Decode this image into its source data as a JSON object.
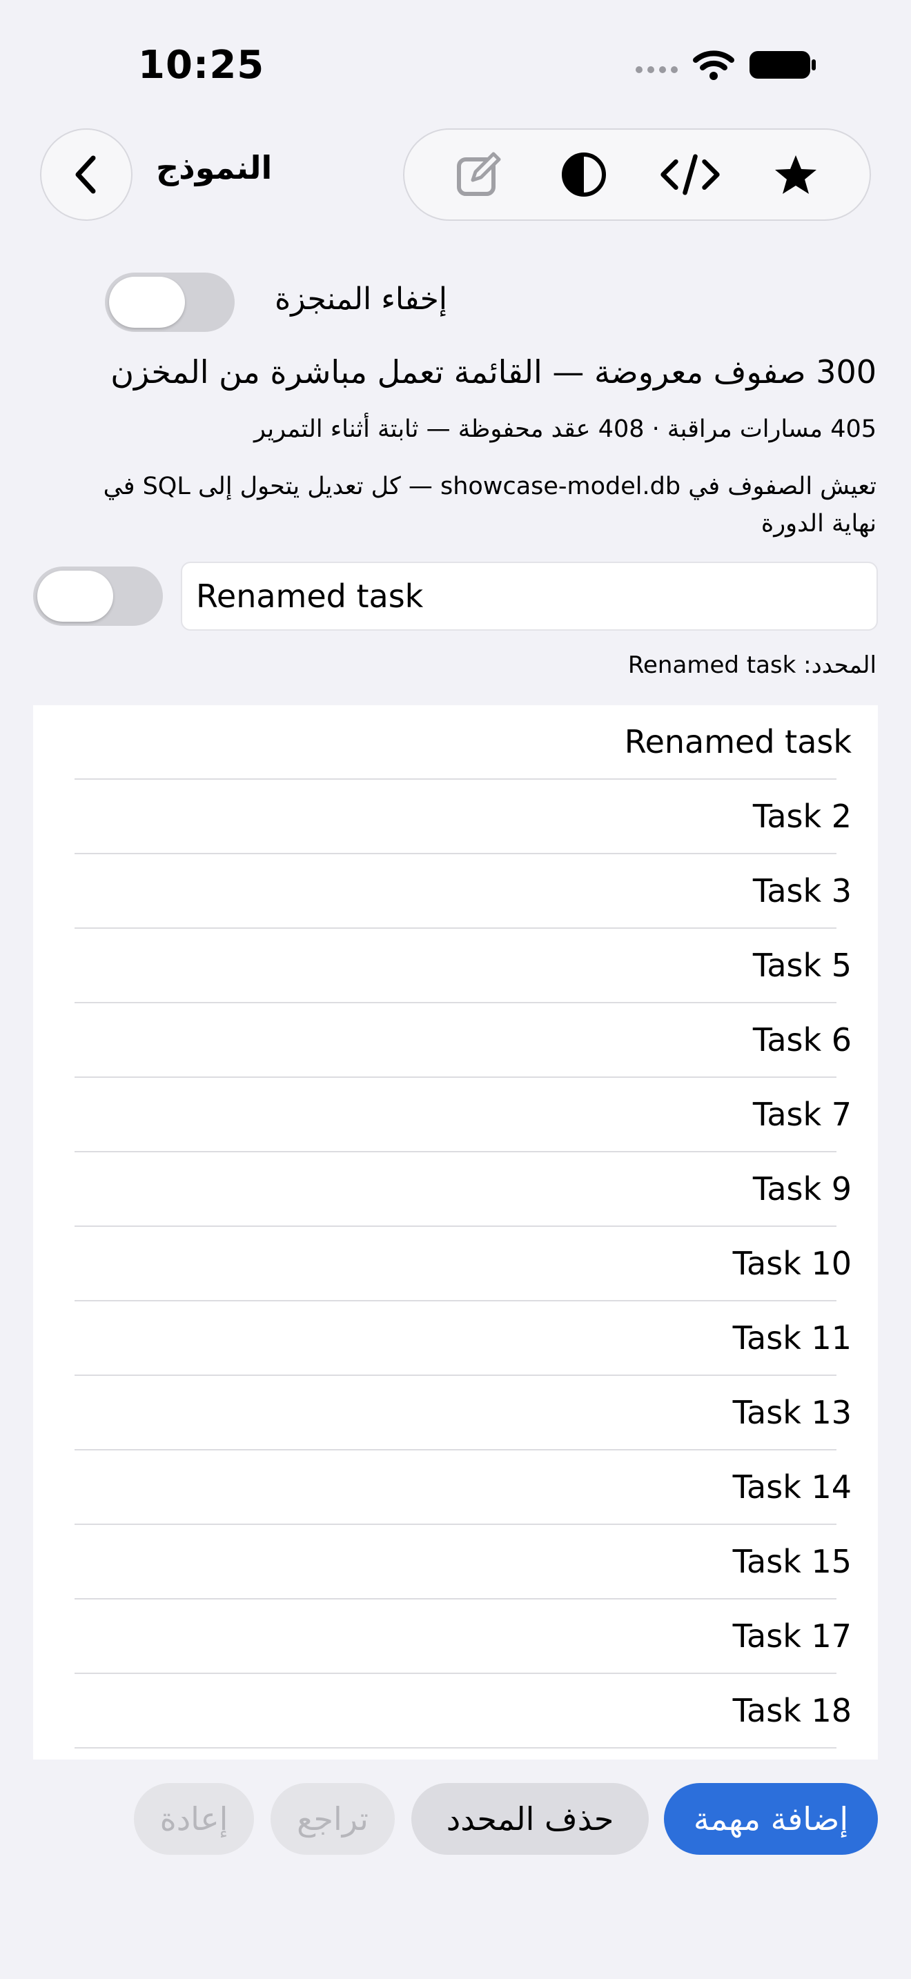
{
  "status_bar": {
    "time": "10:25"
  },
  "nav": {
    "title": "النموذج"
  },
  "toolbar_icons": [
    "compose-icon",
    "contrast-icon",
    "code-icon",
    "star-icon"
  ],
  "hide_completed": {
    "label": "إخفاء المنجزة",
    "on": false
  },
  "info": {
    "headline": "300 صفوف معروضة — القائمة تعمل مباشرة من المخزن",
    "stats": "405 مسارات مراقبة · 408 عقد محفوظة — ثابتة أثناء التمرير",
    "description": "تعيش الصفوف في showcase-model.db — كل تعديل يتحول إلى SQL في نهاية الدورة"
  },
  "editor": {
    "value": "Renamed task",
    "toggle_on": false
  },
  "selection": {
    "text": "المحدد: Renamed task"
  },
  "tasks": [
    "Renamed task",
    "Task 2",
    "Task 3",
    "Task 5",
    "Task 6",
    "Task 7",
    "Task 9",
    "Task 10",
    "Task 11",
    "Task 13",
    "Task 14",
    "Task 15",
    "Task 17",
    "Task 18"
  ],
  "actions": {
    "add": "إضافة مهمة",
    "delete": "حذف المحدد",
    "undo": "تراجع",
    "redo": "إعادة"
  },
  "colors": {
    "accent": "#2c6fdb",
    "background": "#f2f2f7"
  }
}
